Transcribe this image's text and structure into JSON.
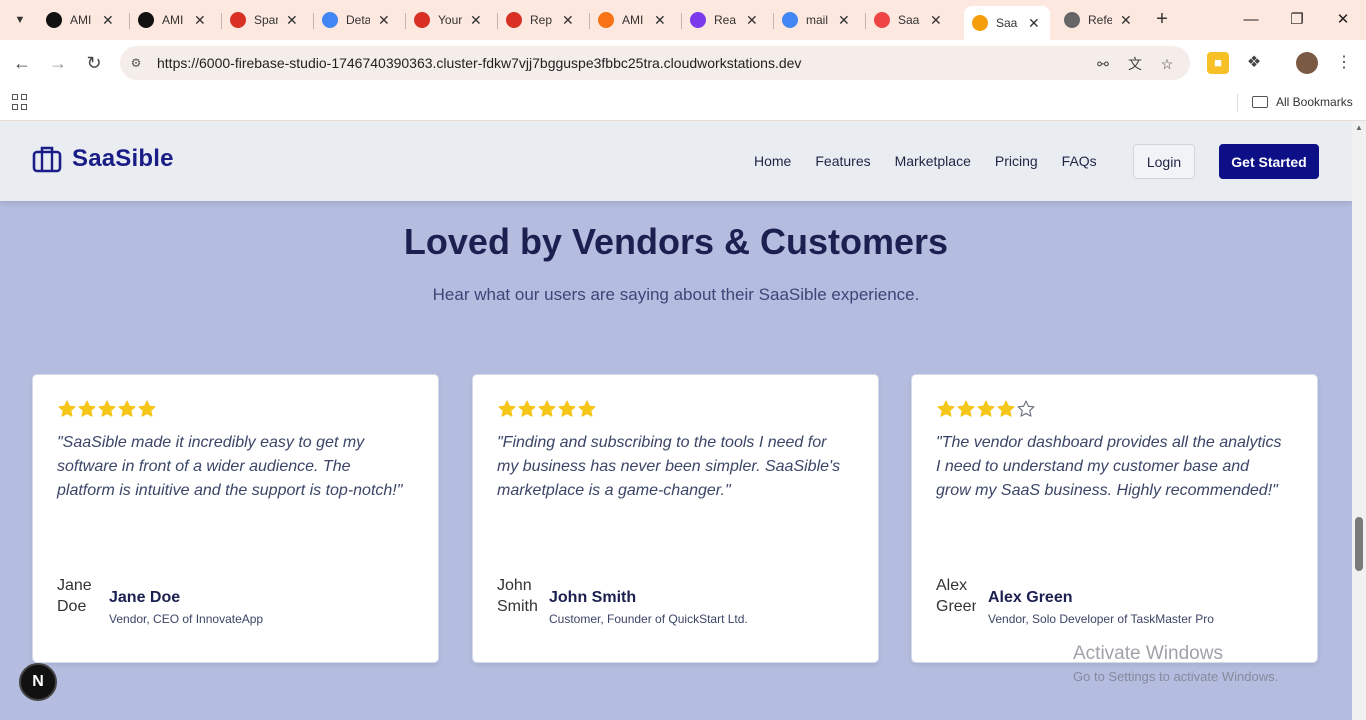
{
  "browser": {
    "tabs": [
      {
        "title": "AMI",
        "favicon": "openai-icon",
        "color": "#111111"
      },
      {
        "title": "AMI",
        "favicon": "github-icon",
        "color": "#111111"
      },
      {
        "title": "Spam",
        "favicon": "gmail-icon",
        "color": "#d93025"
      },
      {
        "title": "Details",
        "favicon": "chrome-store-icon",
        "color": "#4285f4"
      },
      {
        "title": "Your",
        "favicon": "gmail-icon",
        "color": "#d93025"
      },
      {
        "title": "Rep",
        "favicon": "gmail-icon",
        "color": "#d93025"
      },
      {
        "title": "AMI",
        "favicon": "make-icon",
        "color": "#f97316"
      },
      {
        "title": "Rea",
        "favicon": "vite-icon",
        "color": "#7c3aed"
      },
      {
        "title": "mail",
        "favicon": "google-icon",
        "color": "#4285f4"
      },
      {
        "title": "Saa",
        "favicon": "bolt-icon",
        "color": "#ef4444"
      },
      {
        "title": "Saa",
        "favicon": "firebase-studio-icon",
        "color": "#f59e0b",
        "active": true
      },
      {
        "title": "Refe",
        "favicon": "globe-icon",
        "color": "#666666"
      }
    ],
    "url": "https://6000-firebase-studio-1746740390363.cluster-fdkw7vjj7bgguspe3fbbc25tra.cloudworkstations.dev",
    "bookmarks_label": "All Bookmarks"
  },
  "site": {
    "brand": "SaaSible",
    "nav": [
      "Home",
      "Features",
      "Marketplace",
      "Pricing",
      "FAQs"
    ],
    "login_label": "Login",
    "cta_label": "Get Started"
  },
  "testimonials": {
    "title": "Loved by Vendors & Customers",
    "subtitle": "Hear what our users are saying about their SaaSible experience.",
    "cards": [
      {
        "rating": 5,
        "quote": "\"SaaSible made it incredibly easy to get my software in front of a wider audience. The platform is intuitive and the support is top-notch!\"",
        "avatar_alt": "Jane Doe",
        "name": "Jane Doe",
        "role": "Vendor, CEO of InnovateApp"
      },
      {
        "rating": 5,
        "quote": "\"Finding and subscribing to the tools I need for my business has never been simpler. SaaSible's marketplace is a game-changer.\"",
        "avatar_alt": "John Smith",
        "name": "John Smith",
        "role": "Customer, Founder of QuickStart Ltd."
      },
      {
        "rating": 4,
        "quote": "\"The vendor dashboard provides all the analytics I need to understand my customer base and grow my SaaS business. Highly recommended!\"",
        "avatar_alt": "Alex Green",
        "name": "Alex Green",
        "role": "Vendor, Solo Developer of TaskMaster Pro"
      }
    ]
  },
  "dev_badge": "N",
  "watermark": {
    "line1": "Activate Windows",
    "line2": "Go to Settings to activate Windows."
  },
  "colors": {
    "brand": "#1a1d86",
    "cta": "#0d0f87",
    "star": "#f5c518",
    "page_bg": "#b4bddf"
  }
}
